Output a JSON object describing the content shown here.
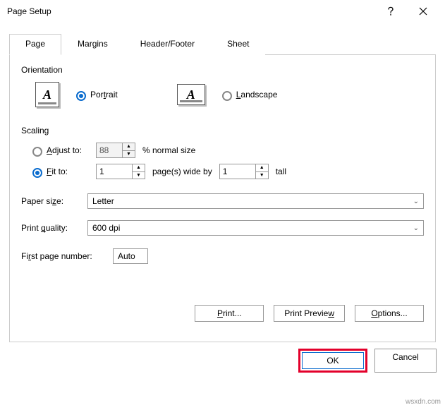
{
  "titlebar": {
    "title": "Page Setup"
  },
  "tabs": {
    "page": "Page",
    "margins": "Margins",
    "header_footer": "Header/Footer",
    "sheet": "Sheet"
  },
  "orientation": {
    "label": "Orientation",
    "portrait": "Portrait",
    "landscape": "Landscape",
    "glyph": "A"
  },
  "scaling": {
    "label": "Scaling",
    "adjust_to": "Adjust to:",
    "adjust_value": "88",
    "adjust_suffix": "% normal size",
    "fit_to": "Fit to:",
    "fit_wide": "1",
    "fit_mid": "page(s) wide by",
    "fit_tall_val": "1",
    "fit_tall_suffix": "tall"
  },
  "paper": {
    "size_label": "Paper size:",
    "size_value": "Letter",
    "quality_label": "Print quality:",
    "quality_value": "600 dpi"
  },
  "firstpage": {
    "label": "First page number:",
    "value": "Auto"
  },
  "buttons": {
    "print": "Print...",
    "preview": "Print Preview",
    "options": "Options...",
    "ok": "OK",
    "cancel": "Cancel"
  },
  "watermark": "wsxdn.com"
}
